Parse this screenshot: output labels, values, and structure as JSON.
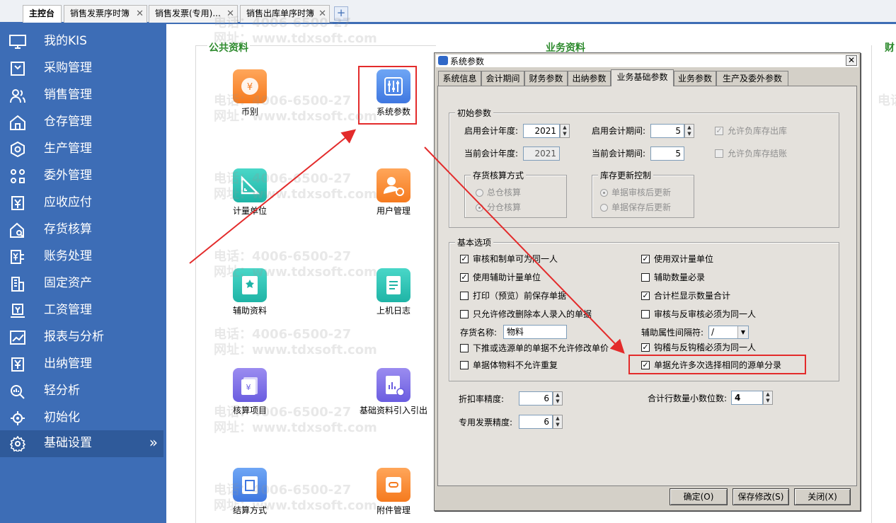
{
  "tabs": [
    {
      "label": "主控台",
      "closable": false
    },
    {
      "label": "销售发票序时簿",
      "closable": true
    },
    {
      "label": "销售发票(专用)...",
      "closable": true
    },
    {
      "label": "销售出库单序时簿",
      "closable": true
    }
  ],
  "sidebar": {
    "items": [
      {
        "label": "我的KIS",
        "icon": "monitor-icon"
      },
      {
        "label": "采购管理",
        "icon": "cart-icon"
      },
      {
        "label": "销售管理",
        "icon": "users-icon"
      },
      {
        "label": "仓存管理",
        "icon": "warehouse-icon"
      },
      {
        "label": "生产管理",
        "icon": "gear-hex-icon"
      },
      {
        "label": "委外管理",
        "icon": "grid-users-icon"
      },
      {
        "label": "应收应付",
        "icon": "yen-money-icon"
      },
      {
        "label": "存货核算",
        "icon": "house-search-icon"
      },
      {
        "label": "账务处理",
        "icon": "ledger-yen-icon"
      },
      {
        "label": "固定资产",
        "icon": "building-icon"
      },
      {
        "label": "工资管理",
        "icon": "salary-icon"
      },
      {
        "label": "报表与分析",
        "icon": "chart-icon"
      },
      {
        "label": "出纳管理",
        "icon": "cashier-icon"
      },
      {
        "label": "轻分析",
        "icon": "analysis-search-icon"
      },
      {
        "label": "初始化",
        "icon": "init-icon"
      },
      {
        "label": "基础设置",
        "icon": "settings-icon",
        "active": true,
        "arrow": "»"
      }
    ]
  },
  "main": {
    "sections": {
      "public": "公共资料",
      "business": "业务资料",
      "finance": "财"
    },
    "tiles": [
      {
        "label": "币别",
        "icon": "currency-icon"
      },
      {
        "label": "系统参数",
        "icon": "system-params-icon"
      },
      {
        "label": "计量单位",
        "icon": "measure-unit-icon"
      },
      {
        "label": "用户管理",
        "icon": "user-manage-icon"
      },
      {
        "label": "辅助资料",
        "icon": "aux-data-icon"
      },
      {
        "label": "上机日志",
        "icon": "log-icon"
      },
      {
        "label": "核算项目",
        "icon": "accounting-item-icon"
      },
      {
        "label": "基础资料引入引出",
        "icon": "import-export-icon"
      },
      {
        "label": "结算方式",
        "icon": "settlement-icon"
      },
      {
        "label": "附件管理",
        "icon": "attachment-icon"
      }
    ],
    "watermark": {
      "phone": "电话：4006-6500-27",
      "site": "网址：www.tdxsoft.com"
    }
  },
  "dialog": {
    "title": "系统参数",
    "close": "✕",
    "tabs": [
      "系统信息",
      "会计期间",
      "财务参数",
      "出纳参数",
      "业务基础参数",
      "业务参数",
      "生产及委外参数"
    ],
    "active_tab": "业务基础参数",
    "init_group": {
      "legend": "初始参数",
      "start_year_label": "启用会计年度:",
      "start_year": "2021",
      "start_period_label": "启用会计期间:",
      "start_period": "5",
      "current_year_label": "当前会计年度:",
      "current_year": "2021",
      "current_period_label": "当前会计期间:",
      "current_period": "5",
      "allow_neg_out": "允许负库存出库",
      "allow_neg_close": "允许负库存结账",
      "costing": {
        "legend": "存货核算方式",
        "opt1": "总仓核算",
        "opt2": "分仓核算"
      },
      "stock_update": {
        "legend": "库存更新控制",
        "opt1": "单据审核后更新",
        "opt2": "单据保存后更新"
      }
    },
    "basic_group": {
      "legend": "基本选项",
      "left": [
        {
          "label": "审核和制单可为同一人",
          "checked": true
        },
        {
          "label": "使用辅助计量单位",
          "checked": true
        },
        {
          "label": "打印（预览）前保存单据",
          "checked": false
        },
        {
          "label": "只允许修改删除本人录入的单据",
          "checked": false
        }
      ],
      "right": [
        {
          "label": "使用双计量单位",
          "checked": true
        },
        {
          "label": "辅助数量必录",
          "checked": false
        },
        {
          "label": "合计栏显示数量合计",
          "checked": true
        },
        {
          "label": "审核与反审核必须为同一人",
          "checked": false
        }
      ],
      "stock_name_label": "存货名称:",
      "stock_name": "物料",
      "aux_sep_label": "辅助属性间隔符:",
      "aux_sep": "/",
      "left2": [
        {
          "label": "下推或选源单的单据不允许修改单价",
          "checked": false
        },
        {
          "label": "单据体物料不允许重复",
          "checked": false
        }
      ],
      "right2": [
        {
          "label": "钩稽与反钩稽必须为同一人",
          "checked": true
        },
        {
          "label": "单据允许多次选择相同的源单分录",
          "checked": true
        }
      ]
    },
    "precision": {
      "discount_label": "折扣率精度:",
      "discount": "6",
      "total_qty_label": "合计行数量小数位数:",
      "total_qty": "4",
      "invoice_label": "专用发票精度:",
      "invoice": "6"
    },
    "buttons": {
      "ok": "确定(O)",
      "save": "保存修改(S)",
      "close": "关闭(X)"
    }
  }
}
